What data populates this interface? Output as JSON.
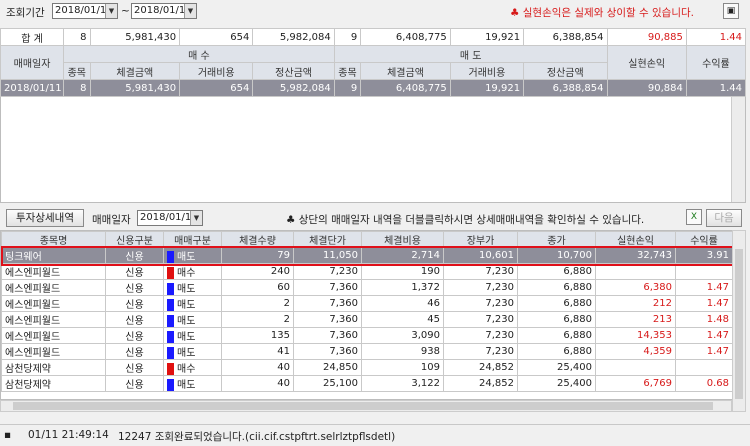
{
  "query": {
    "period_label": "조회기간",
    "start_date": "2018/01/11",
    "tilde": "~",
    "end_date": "2018/01/11",
    "warning": "♣ 실현손익은 실제와 상이할 수 있습니다."
  },
  "summary": {
    "total_label": "합 계",
    "total": [
      "8",
      "5,981,430",
      "654",
      "5,982,084",
      "9",
      "6,408,775",
      "19,921",
      "6,388,854",
      "90,885",
      "1.44"
    ],
    "headers": {
      "date": "매매일자",
      "buy": "매 수",
      "sell": "매 도",
      "realized": "실현손익",
      "return": "수익률",
      "items": "종목",
      "exec_amount": "체결금액",
      "fee": "거래비용",
      "settle_amount": "정산금액"
    },
    "rows": [
      [
        "2018/01/11",
        "8",
        "5,981,430",
        "654",
        "5,982,084",
        "9",
        "6,408,775",
        "19,921",
        "6,388,854",
        "90,884",
        "1.44"
      ]
    ]
  },
  "mid": {
    "detail_button": "투자상세내역",
    "trade_date_label": "매매일자",
    "trade_date": "2018/01/11",
    "hint": "♣ 상단의 매매일자 내역을 더블클릭하시면 상세매매내역을 확인하실 수 있습니다.",
    "next_button": "다음"
  },
  "detail": {
    "headers": [
      "종목명",
      "신용구분",
      "매매구분",
      "체결수량",
      "체결단가",
      "체결비용",
      "장부가",
      "종가",
      "실현손익",
      "수익률"
    ],
    "rows": [
      {
        "name": "팅크웨어",
        "credit": "신용",
        "side": "매도",
        "color": "#1a1aff",
        "qty": "79",
        "price": "11,050",
        "cost": "2,714",
        "book": "10,601",
        "close": "10,700",
        "pnl": "32,743",
        "ret": "3.91"
      },
      {
        "name": "에스엔피월드",
        "credit": "신용",
        "side": "매수",
        "color": "#e01010",
        "qty": "240",
        "price": "7,230",
        "cost": "190",
        "book": "7,230",
        "close": "6,880",
        "pnl": "",
        "ret": ""
      },
      {
        "name": "에스엔피월드",
        "credit": "신용",
        "side": "매도",
        "color": "#1a1aff",
        "qty": "60",
        "price": "7,360",
        "cost": "1,372",
        "book": "7,230",
        "close": "6,880",
        "pnl": "6,380",
        "ret": "1.47"
      },
      {
        "name": "에스엔피월드",
        "credit": "신용",
        "side": "매도",
        "color": "#1a1aff",
        "qty": "2",
        "price": "7,360",
        "cost": "46",
        "book": "7,230",
        "close": "6,880",
        "pnl": "212",
        "ret": "1.47"
      },
      {
        "name": "에스엔피월드",
        "credit": "신용",
        "side": "매도",
        "color": "#1a1aff",
        "qty": "2",
        "price": "7,360",
        "cost": "45",
        "book": "7,230",
        "close": "6,880",
        "pnl": "213",
        "ret": "1.48"
      },
      {
        "name": "에스엔피월드",
        "credit": "신용",
        "side": "매도",
        "color": "#1a1aff",
        "qty": "135",
        "price": "7,360",
        "cost": "3,090",
        "book": "7,230",
        "close": "6,880",
        "pnl": "14,353",
        "ret": "1.47"
      },
      {
        "name": "에스엔피월드",
        "credit": "신용",
        "side": "매도",
        "color": "#1a1aff",
        "qty": "41",
        "price": "7,360",
        "cost": "938",
        "book": "7,230",
        "close": "6,880",
        "pnl": "4,359",
        "ret": "1.47"
      },
      {
        "name": "삼천당제약",
        "credit": "신용",
        "side": "매수",
        "color": "#e01010",
        "qty": "40",
        "price": "24,850",
        "cost": "109",
        "book": "24,852",
        "close": "25,400",
        "pnl": "",
        "ret": ""
      },
      {
        "name": "삼천당제약",
        "credit": "신용",
        "side": "매도",
        "color": "#1a1aff",
        "qty": "40",
        "price": "25,100",
        "cost": "3,122",
        "book": "24,852",
        "close": "25,400",
        "pnl": "6,769",
        "ret": "0.68"
      }
    ]
  },
  "status": {
    "time": "01/11 21:49:14",
    "message": "12247 조회완료되었습니다.(cii.cif.cstpftrt.selrlztpflsdetl)"
  }
}
